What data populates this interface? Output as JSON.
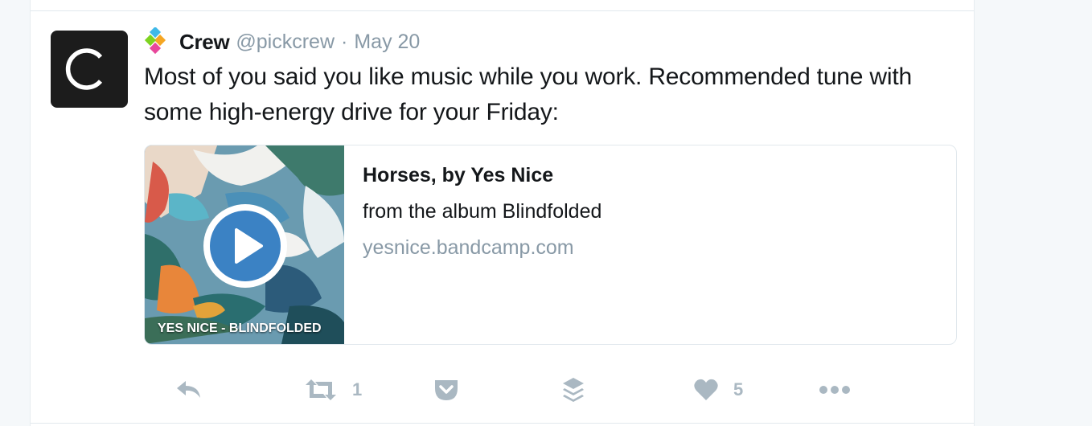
{
  "tweet": {
    "author_name": "Crew",
    "handle": "@pickcrew",
    "separator": "·",
    "timestamp": "May 20",
    "text": "Most of you said you like music while you work. Recommended tune with some high-energy drive for your Friday:",
    "avatar_letter": "C",
    "avatar_color": "#1c1c1c"
  },
  "card": {
    "title": "Horses, by Yes Nice",
    "description": "from the album Blindfolded",
    "domain": "yesnice.bandcamp.com",
    "album_caption": "YES NICE - BLINDFOLDED",
    "play_icon": "play-icon",
    "play_color": "#3b82c4"
  },
  "actions": {
    "reply": {
      "icon": "reply-icon"
    },
    "retweet": {
      "icon": "retweet-icon",
      "count": "1"
    },
    "pocket": {
      "icon": "pocket-icon"
    },
    "buffer": {
      "icon": "buffer-icon"
    },
    "like": {
      "icon": "heart-icon",
      "count": "5"
    },
    "more": {
      "icon": "more-icon"
    }
  },
  "colors": {
    "text": "#14171a",
    "muted": "#8899a6",
    "icon": "#aab8c2",
    "border": "#e1e8ed"
  }
}
